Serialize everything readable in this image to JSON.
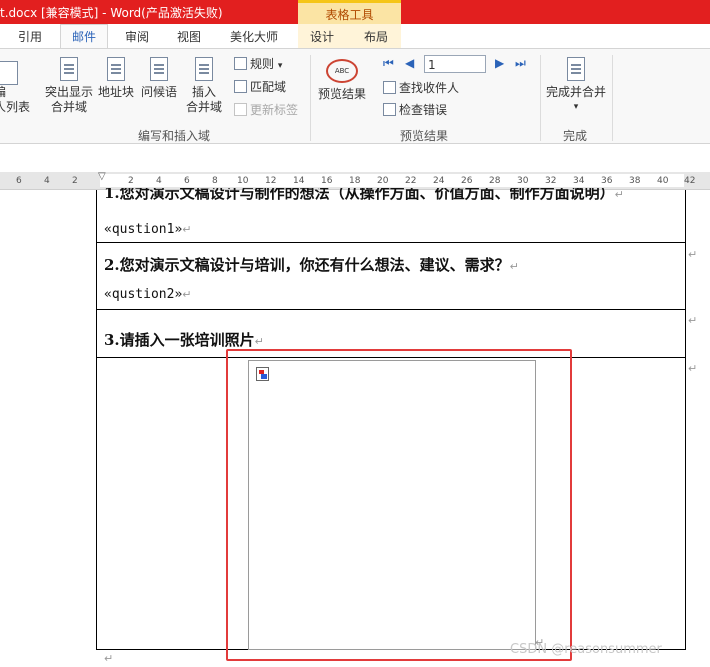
{
  "titlebar": {
    "title": "t.docx [兼容模式] - Word(产品激活失败)",
    "context_tools": "表格工具"
  },
  "tabs": [
    "引用",
    "邮件",
    "审阅",
    "视图",
    "美化大师",
    "设计",
    "布局"
  ],
  "ribbon": {
    "edit_list_partial": "编\n人列表",
    "highlight_fields": "突出显示\n合并域",
    "address_block": "地址块",
    "greeting_line": "问候语",
    "insert_field": "插入\n合并域",
    "rules": "规则",
    "match_fields": "匹配域",
    "update_labels": "更新标签",
    "group_write_insert": "编写和插入域",
    "preview_results_btn": "预览结果",
    "record_number": "1",
    "find_recipient": "查找收件人",
    "check_errors": "检查错误",
    "group_preview": "预览结果",
    "finish_merge": "完成并合并",
    "group_finish": "完成"
  },
  "ruler": [
    "6",
    "4",
    "2",
    "2",
    "4",
    "6",
    "8",
    "10",
    "12",
    "14",
    "16",
    "18",
    "20",
    "22",
    "24",
    "26",
    "28",
    "30",
    "32",
    "34",
    "36",
    "38",
    "40",
    "42"
  ],
  "document": {
    "q1_partial": "1.您对演示文稿设计与制作的想法（从操作方面、价值方面、制作方面说明）",
    "merge1": "«qustion1»",
    "q2": "2.您对演示文稿设计与培训，你还有什么想法、建议、需求？",
    "merge2": "«qustion2»",
    "q3": "3.请插入一张培训照片"
  },
  "marks": {
    "para": "↵"
  },
  "watermark": "CSDN @reasonsummer"
}
